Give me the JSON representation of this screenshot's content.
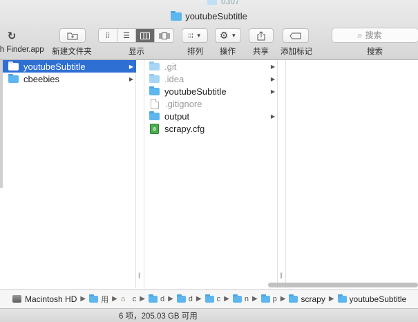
{
  "window": {
    "background_tab": "0307",
    "title": "youtubeSubtitle"
  },
  "toolbar": {
    "back_label": "sh Finder.app",
    "new_folder_label": "新建文件夹",
    "view_label": "显示",
    "arrange_label": "排列",
    "action_label": "操作",
    "share_label": "共享",
    "add_tag_label": "添加标记",
    "search_label": "搜索",
    "search_placeholder": "搜索"
  },
  "column1": {
    "items": [
      {
        "name": "youtubeSubtitle",
        "kind": "folder",
        "selected": true
      },
      {
        "name": "cbeebies",
        "kind": "folder",
        "selected": false
      }
    ]
  },
  "column2": {
    "items": [
      {
        "name": ".git",
        "kind": "folder",
        "hidden": true
      },
      {
        "name": ".idea",
        "kind": "folder",
        "hidden": true
      },
      {
        "name": "youtubeSubtitle",
        "kind": "folder",
        "hidden": false
      },
      {
        "name": ".gitignore",
        "kind": "file",
        "hidden": true
      },
      {
        "name": "output",
        "kind": "folder",
        "hidden": false
      },
      {
        "name": "scrapy.cfg",
        "kind": "cfg",
        "hidden": false
      }
    ]
  },
  "pathbar": {
    "drive": "Macintosh HD",
    "segments": [
      "用",
      "c",
      "d",
      "d",
      "c",
      "n",
      "p"
    ],
    "scrapy": "scrapy",
    "current": "youtubeSubtitle"
  },
  "status": {
    "text": "6 项，205.03 GB 可用"
  },
  "colors": {
    "selection": "#2e6fd3",
    "folder": "#5eb6ee"
  }
}
